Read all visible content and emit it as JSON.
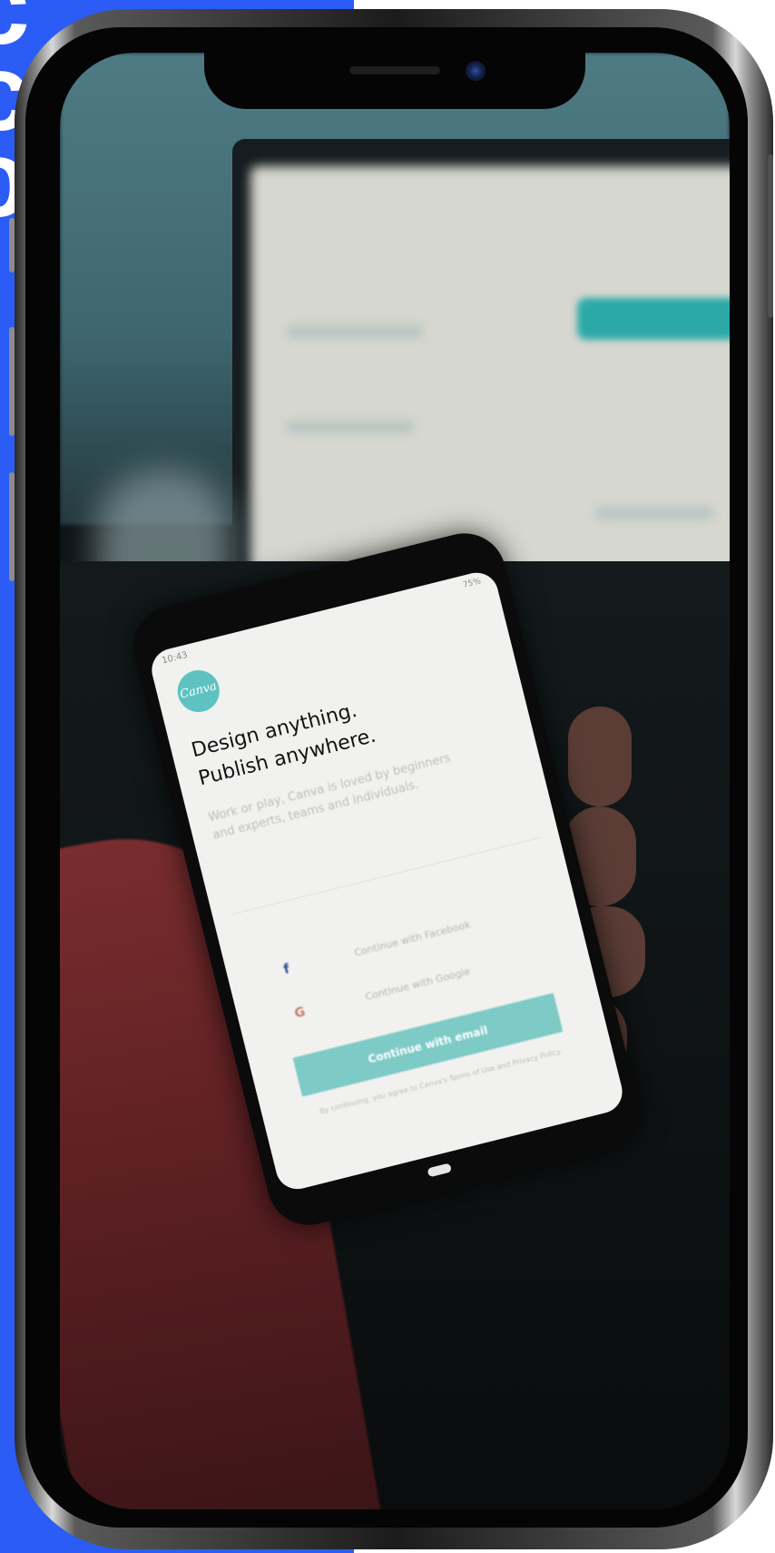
{
  "held_phone": {
    "status_time": "10:43",
    "status_battery": "75%",
    "logo_text": "Canva",
    "title_line1": "Design anything.",
    "title_line2": "Publish anywhere.",
    "description": "Work or play, Canva is loved by beginners and experts, teams and individuals.",
    "facebook_label": "Continue with Facebook",
    "facebook_icon": "f",
    "google_label": "Continue with Google",
    "google_icon": "G",
    "email_button": "Continue with email",
    "terms": "By continuing, you agree to Canva's Terms of Use and Privacy Policy."
  },
  "colors": {
    "blue_panel": "#2b5cf5",
    "canva_teal": "#5ec3c0",
    "email_button": "#7dcac6"
  }
}
